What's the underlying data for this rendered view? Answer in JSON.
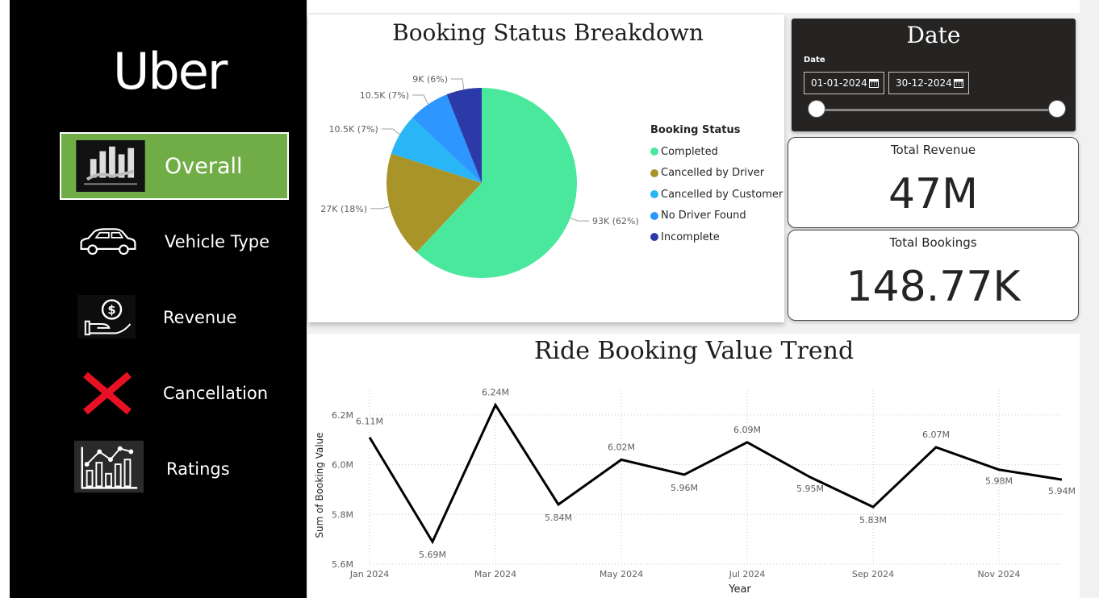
{
  "sidebar": {
    "logo": "Uber",
    "items": [
      {
        "label": "Overall",
        "icon": "bar-chart-hand-icon",
        "active": true
      },
      {
        "label": "Vehicle Type",
        "icon": "car-icon",
        "active": false
      },
      {
        "label": "Revenue",
        "icon": "money-hand-icon",
        "active": false
      },
      {
        "label": "Cancellation",
        "icon": "red-x-icon",
        "active": false
      },
      {
        "label": "Ratings",
        "icon": "line-bar-chart-icon",
        "active": false
      }
    ]
  },
  "pie": {
    "title": "Booking Status Breakdown",
    "legend_title": "Booking Status",
    "slices": [
      {
        "name": "Completed",
        "label": "93K (62%)",
        "value": 93,
        "color": "#4ae89d"
      },
      {
        "name": "Cancelled by Driver",
        "label": "27K (18%)",
        "value": 27,
        "color": "#a89429"
      },
      {
        "name": "Cancelled by Customer",
        "label": "10.5K (7%)",
        "value": 10.5,
        "color": "#29b6f6"
      },
      {
        "name": "No Driver Found",
        "label": "10.5K (7%)",
        "value": 10.5,
        "color": "#2d96ff"
      },
      {
        "name": "Incomplete",
        "label": "9K (6%)",
        "value": 9,
        "color": "#2c3aa8"
      }
    ]
  },
  "date_filter": {
    "title": "Date",
    "label": "Date",
    "start": "01-01-2024",
    "end": "30-12-2024"
  },
  "kpis": {
    "revenue_label": "Total Revenue",
    "revenue_value": "47M",
    "bookings_label": "Total Bookings",
    "bookings_value": "148.77K"
  },
  "chart_data": {
    "type": "line",
    "title": "Ride Booking Value Trend",
    "xlabel": "Year",
    "ylabel": "Sum of Booking Value",
    "x": [
      "Jan 2024",
      "Feb 2024",
      "Mar 2024",
      "Apr 2024",
      "May 2024",
      "Jun 2024",
      "Jul 2024",
      "Aug 2024",
      "Sep 2024",
      "Oct 2024",
      "Nov 2024",
      "Dec 2024"
    ],
    "x_tick_labels": [
      "Jan 2024",
      "Mar 2024",
      "May 2024",
      "Jul 2024",
      "Sep 2024",
      "Nov 2024"
    ],
    "values": [
      6.11,
      5.69,
      6.24,
      5.84,
      6.02,
      5.96,
      6.09,
      5.95,
      5.83,
      6.07,
      5.98,
      5.94
    ],
    "data_labels": [
      "6.11M",
      "5.69M",
      "6.24M",
      "5.84M",
      "6.02M",
      "5.96M",
      "6.09M",
      "5.95M",
      "5.83M",
      "6.07M",
      "5.98M",
      "5.94M"
    ],
    "y_ticks": [
      "5.6M",
      "5.8M",
      "6.0M",
      "6.2M"
    ],
    "y_tick_values": [
      5.6,
      5.8,
      6.0,
      6.2
    ],
    "ylim": [
      5.6,
      6.3
    ],
    "grid": true,
    "line_color": "#000000"
  }
}
